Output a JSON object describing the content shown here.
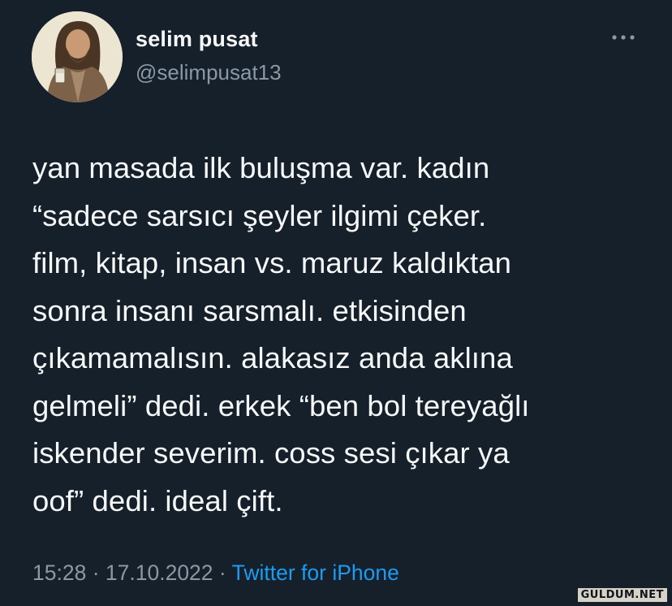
{
  "user": {
    "display_name": "selim pusat",
    "handle": "@selimpusat13"
  },
  "tweet": {
    "text": "yan masada ilk buluşma var. kadın\n“sadece sarsıcı şeyler ilgimi çeker.\nfilm, kitap, insan vs. maruz kaldıktan\nsonra insanı sarsmalı. etkisinden\nçıkamamalısın. alakasız anda aklına\ngelmeli” dedi. erkek “ben bol tereyağlı\niskender severim. coss sesi çıkar ya\noof” dedi. ideal çift.",
    "time": "15:28",
    "date": "17.10.2022",
    "separator": "·",
    "source": "Twitter for iPhone"
  },
  "watermark": "GULDUM.NET",
  "colors": {
    "background": "#15202b",
    "text": "#f7f9f9",
    "secondary": "#8b98a5",
    "link": "#1d9bf0"
  },
  "icons": {
    "more": "more-horizontal-icon"
  }
}
